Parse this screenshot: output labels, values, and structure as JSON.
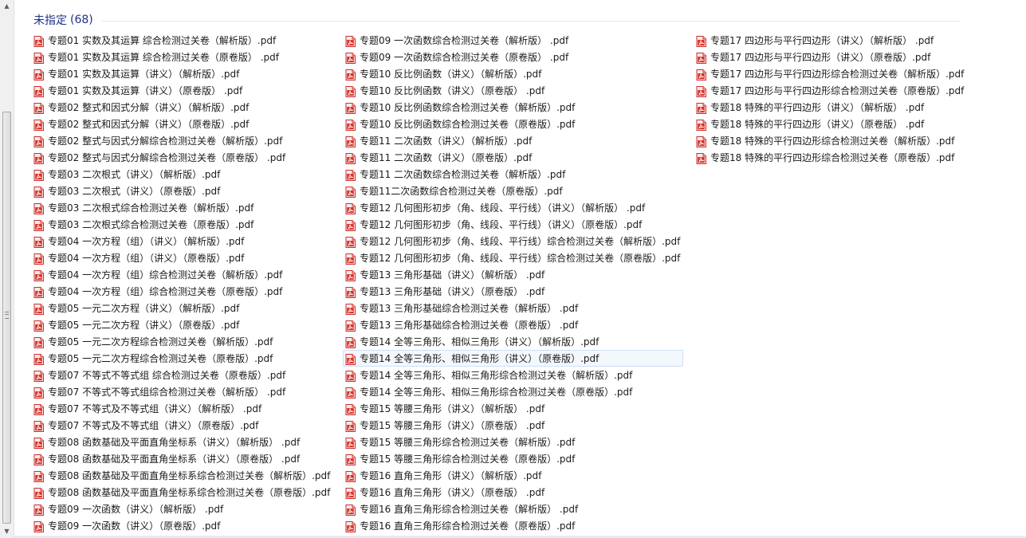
{
  "group": {
    "title": "未指定",
    "count": "(68)"
  },
  "scrollbar": {
    "up_arrow": "▲",
    "down_arrow": "▼"
  },
  "icon": "pdf-file-icon",
  "selected_file": "专题14 全等三角形、相似三角形（讲义）（原卷版）.pdf",
  "columns": [
    [
      "专题01 实数及其运算 综合检测过关卷（解析版）.pdf",
      "专题01 实数及其运算 综合检测过关卷（原卷版） .pdf",
      "专题01 实数及其运算（讲义）（解析版）.pdf",
      "专题01 实数及其运算（讲义）（原卷版） .pdf",
      "专题02 整式和因式分解（讲义）（解析版）.pdf",
      "专题02 整式和因式分解（讲义）（原卷版）.pdf",
      "专题02 整式与因式分解综合检测过关卷（解析版）.pdf",
      "专题02 整式与因式分解综合检测过关卷（原卷版） .pdf",
      "专题03 二次根式（讲义）（解析版）.pdf",
      "专题03 二次根式（讲义）（原卷版）.pdf",
      "专题03 二次根式综合检测过关卷（解析版）.pdf",
      "专题03 二次根式综合检测过关卷（原卷版）.pdf",
      "专题04 一次方程（组）（讲义）（解析版）.pdf",
      "专题04 一次方程（组）（讲义）（原卷版）.pdf",
      "专题04 一次方程（组）综合检测过关卷（解析版）.pdf",
      "专题04 一次方程（组）综合检测过关卷（原卷版）.pdf",
      "专题05 一元二次方程（讲义）（解析版）.pdf",
      "专题05 一元二次方程（讲义）（原卷版）.pdf",
      "专题05 一元二次方程综合检测过关卷（解析版）.pdf",
      "专题05 一元二次方程综合检测过关卷（原卷版）.pdf",
      "专题07 不等式不等式组 综合检测过关卷（原卷版）.pdf",
      "专题07 不等式不等式组综合检测过关卷（解析版） .pdf",
      "专题07 不等式及不等式组（讲义）（解析版） .pdf",
      "专题07 不等式及不等式组（讲义）（原卷版）.pdf",
      "专题08 函数基础及平面直角坐标系（讲义）（解析版） .pdf",
      "专题08 函数基础及平面直角坐标系（讲义）（原卷版） .pdf",
      "专题08 函数基础及平面直角坐标系综合检测过关卷（解析版）.pdf",
      "专题08 函数基础及平面直角坐标系综合检测过关卷（原卷版）.pdf",
      "专题09 一次函数（讲义）（解析版） .pdf",
      "专题09 一次函数（讲义）（原卷版）.pdf"
    ],
    [
      "专题09 一次函数综合检测过关卷（解析版） .pdf",
      "专题09 一次函数综合检测过关卷（原卷版） .pdf",
      "专题10 反比例函数（讲义）（解析版）.pdf",
      "专题10 反比例函数（讲义）（原卷版） .pdf",
      "专题10 反比例函数综合检测过关卷（解析版）.pdf",
      "专题10 反比例函数综合检测过关卷（原卷版）.pdf",
      "专题11 二次函数（讲义）（解析版）.pdf",
      "专题11 二次函数（讲义）（原卷版）.pdf",
      "专题11 二次函数综合检测过关卷（解析版）.pdf",
      "专题11二次函数综合检测过关卷（原卷版）.pdf",
      "专题12 几何图形初步（角、线段、平行线）（讲义）（解析版） .pdf",
      "专题12 几何图形初步（角、线段、平行线）（讲义）（原卷版）.pdf",
      "专题12 几何图形初步（角、线段、平行线）综合检测过关卷（解析版）.pdf",
      "专题12 几何图形初步（角、线段、平行线）综合检测过关卷（原卷版）.pdf",
      "专题13 三角形基础（讲义）（解析版） .pdf",
      "专题13 三角形基础（讲义）（原卷版） .pdf",
      "专题13 三角形基础综合检测过关卷（解析版） .pdf",
      "专题13 三角形基础综合检测过关卷（原卷版） .pdf",
      "专题14 全等三角形、相似三角形（讲义）（解析版）.pdf",
      "专题14 全等三角形、相似三角形（讲义）（原卷版）.pdf",
      "专题14 全等三角形、相似三角形综合检测过关卷（解析版）.pdf",
      "专题14 全等三角形、相似三角形综合检测过关卷（原卷版）.pdf",
      "专题15 等腰三角形（讲义）（解析版） .pdf",
      "专题15 等腰三角形（讲义）（原卷版） .pdf",
      "专题15 等腰三角形综合检测过关卷（解析版）.pdf",
      "专题15 等腰三角形综合检测过关卷（原卷版）.pdf",
      "专题16  直角三角形（讲义）（解析版）.pdf",
      "专题16  直角三角形（讲义）（原卷版） .pdf",
      "专题16 直角三角形综合检测过关卷（解析版） .pdf",
      "专题16 直角三角形综合检测过关卷（原卷版）.pdf"
    ],
    [
      "专题17 四边形与平行四边形（讲义）（解析版） .pdf",
      "专题17 四边形与平行四边形（讲义）（原卷版）.pdf",
      "专题17 四边形与平行四边形综合检测过关卷（解析版）.pdf",
      "专题17 四边形与平行四边形综合检测过关卷（原卷版）.pdf",
      "专题18 特殊的平行四边形（讲义）（解析版） .pdf",
      "专题18 特殊的平行四边形（讲义）（原卷版）  .pdf",
      "专题18 特殊的平行四边形综合检测过关卷（解析版）.pdf",
      "专题18 特殊的平行四边形综合检测过关卷（原卷版）.pdf"
    ]
  ]
}
